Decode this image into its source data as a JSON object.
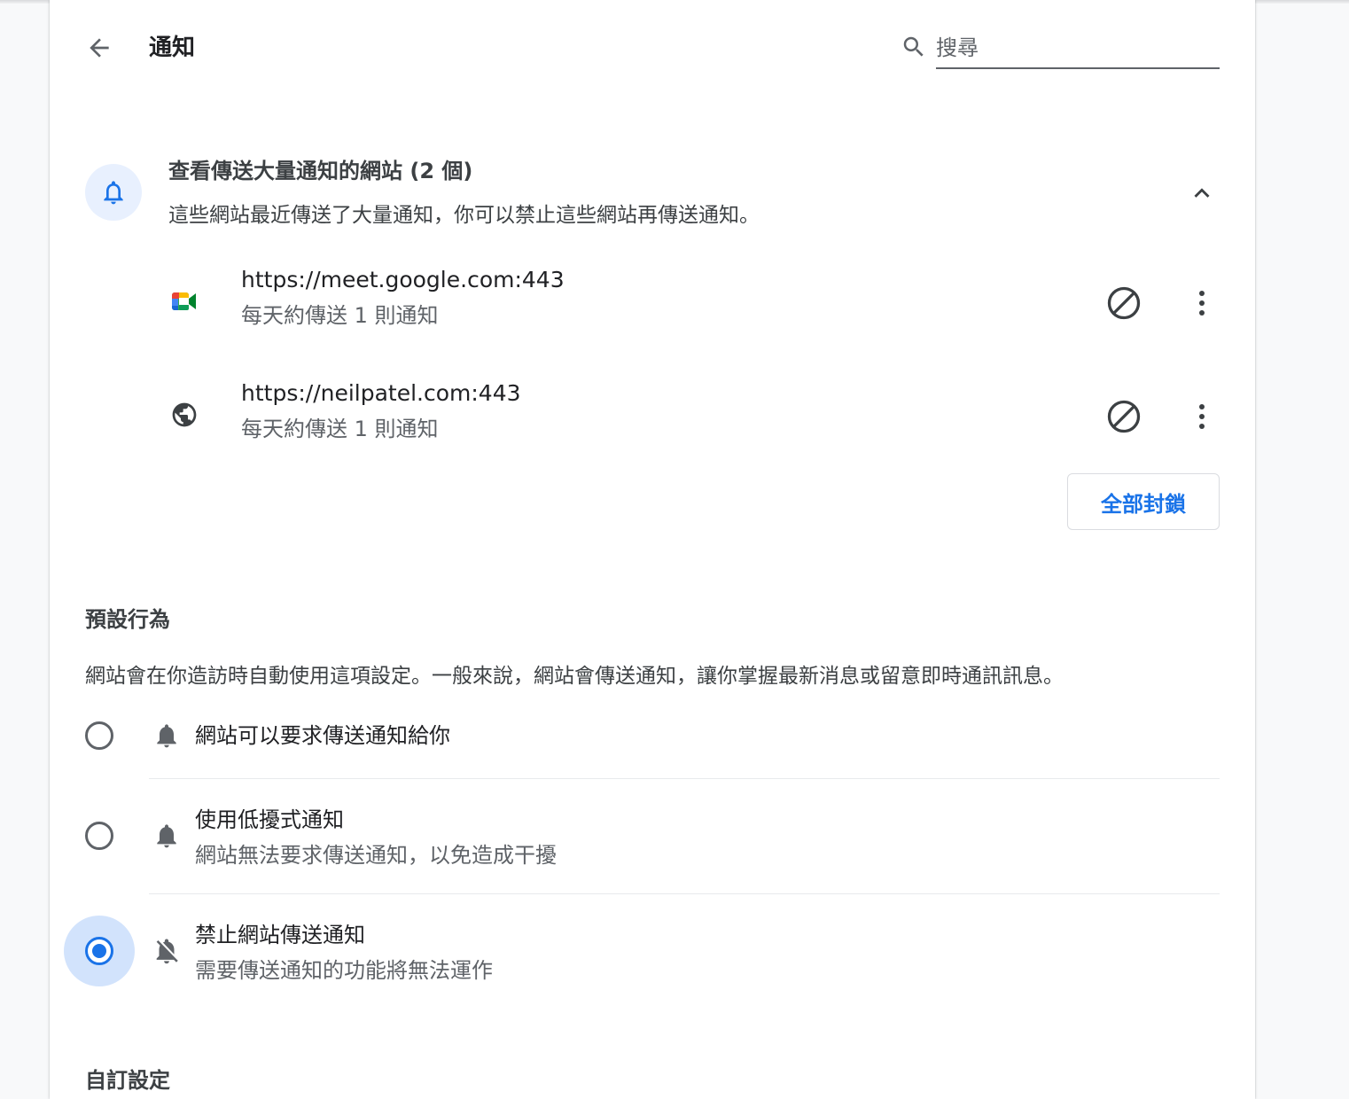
{
  "header": {
    "title": "通知",
    "search_placeholder": "搜尋"
  },
  "review": {
    "title": "查看傳送大量通知的網站 (2 個)",
    "description": "這些網站最近傳送了大量通知，你可以禁止這些網站再傳送通知。",
    "sites": [
      {
        "url": "https://meet.google.com:443",
        "frequency": "每天約傳送 1 則通知",
        "icon": "google-meet-icon"
      },
      {
        "url": "https://neilpatel.com:443",
        "frequency": "每天約傳送 1 則通知",
        "icon": "globe-icon"
      }
    ],
    "block_all_label": "全部封鎖"
  },
  "default_behavior": {
    "heading": "預設行為",
    "description": "網站會在你造訪時自動使用這項設定。一般來說，網站會傳送通知，讓你掌握最新消息或留意即時通訊訊息。",
    "options": [
      {
        "label": "網站可以要求傳送通知給你",
        "sub": "",
        "icon": "bell-icon",
        "selected": false
      },
      {
        "label": "使用低擾式通知",
        "sub": "網站無法要求傳送通知，以免造成干擾",
        "icon": "bell-icon",
        "selected": false
      },
      {
        "label": "禁止網站傳送通知",
        "sub": "需要傳送通知的功能將無法運作",
        "icon": "bell-off-icon",
        "selected": true
      }
    ]
  },
  "custom": {
    "heading": "自訂設定"
  },
  "colors": {
    "accent": "#1a73e8",
    "icon_gray": "#5f6368",
    "selected_halo": "#d2e3fc"
  }
}
